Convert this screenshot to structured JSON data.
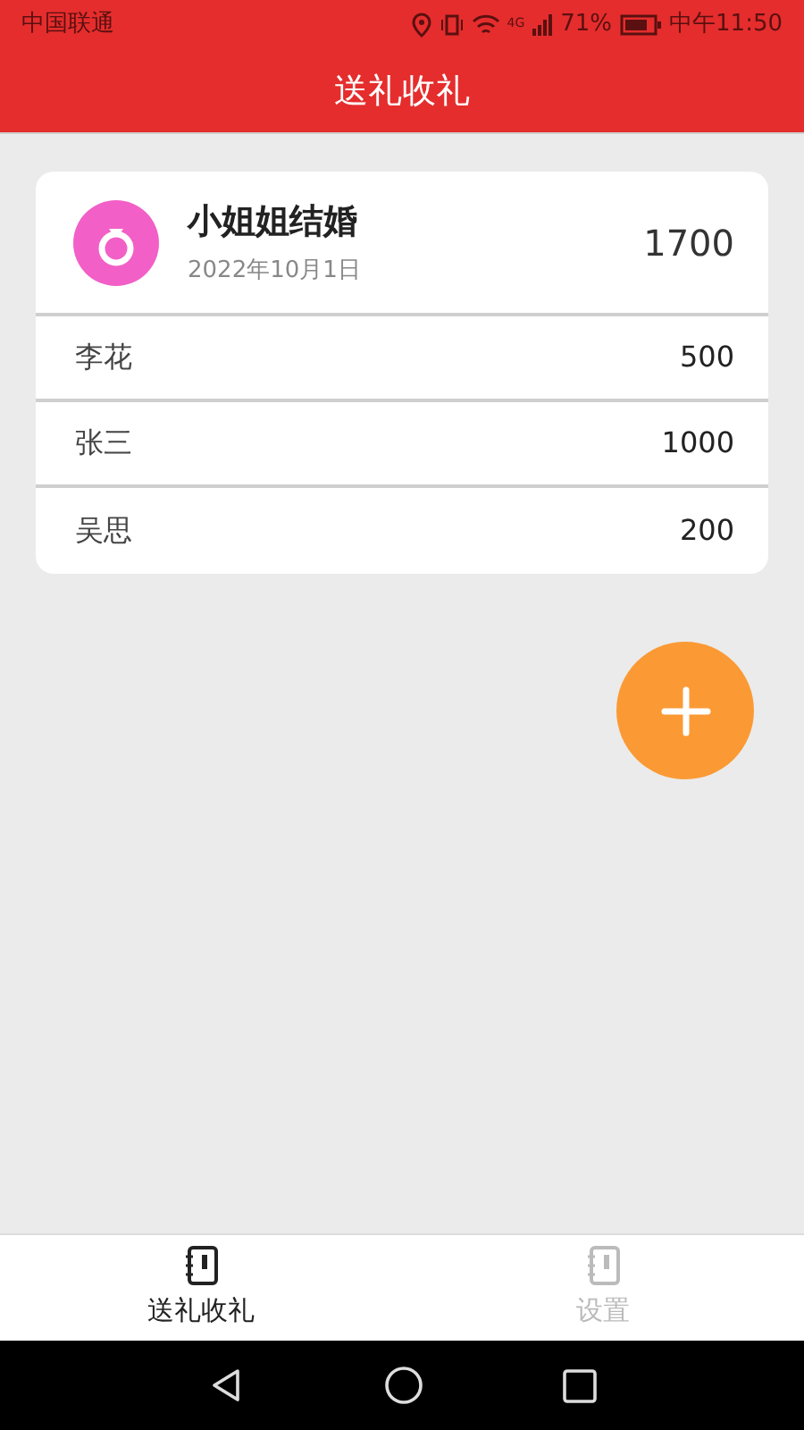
{
  "status_bar": {
    "carrier": "中国联通",
    "signal_label": "4G",
    "battery": "71%",
    "time": "中午11:50"
  },
  "title": "送礼收礼",
  "event": {
    "name": "小姐姐结婚",
    "date": "2022年10月1日",
    "total": "1700",
    "entries": [
      {
        "name": "李花",
        "amount": "500"
      },
      {
        "name": "张三",
        "amount": "1000"
      },
      {
        "name": "吴思",
        "amount": "200"
      }
    ]
  },
  "tabs": [
    {
      "label": "送礼收礼",
      "selected": true
    },
    {
      "label": "设置",
      "selected": false
    }
  ]
}
